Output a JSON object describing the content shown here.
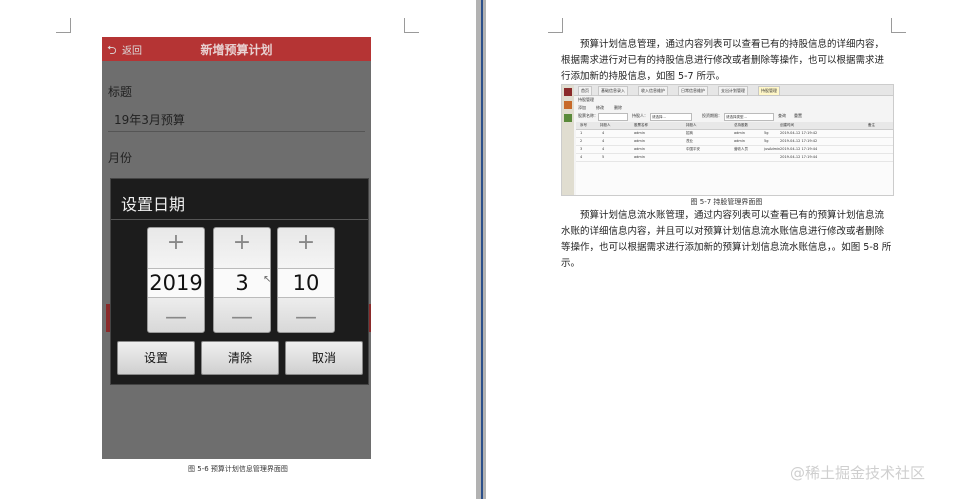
{
  "left_page": {
    "phone": {
      "back_label": "返回",
      "title": "新增预算计划",
      "fields": [
        {
          "label": "标题",
          "value": "19年3月预算"
        },
        {
          "label": "月份",
          "value": ""
        }
      ],
      "dialog": {
        "title": "设置日期",
        "plus": "+",
        "minus": "—",
        "year": "2019",
        "month": "3",
        "day": "10",
        "buttons": [
          "设置",
          "清除",
          "取消"
        ]
      }
    },
    "caption": "图 5-6 预算计划信息管理界面图"
  },
  "right_page": {
    "para1": "预算计划信息管理，通过内容列表可以查看已有的持股信息的详细内容，根据需求进行对已有的持股信息进行修改或者删除等操作，也可以根据需求进行添加新的持股信息，如图 5-7 所示。",
    "admin": {
      "tabs": [
        "首页",
        "基础信息录入",
        "收入信息维护",
        "日常信息维护",
        "支出计划管理",
        "持股管理"
      ],
      "header_title": "持股管理",
      "tools": [
        "添加",
        "修改",
        "删除"
      ],
      "search_labels": [
        "股票名称：",
        "持股人：",
        "投资期限：",
        "关闭"
      ],
      "search_placeholders": [
        "请选择...",
        "请选择...",
        "请选择类型..."
      ],
      "search_buttons": [
        "查询",
        "重置"
      ],
      "columns": [
        "序号",
        "持股人",
        "股票名称",
        "持股人",
        "总持股数",
        "创建时间",
        "备注"
      ],
      "rows": [
        [
          "1",
          "4",
          "admin",
          "招商",
          "admin",
          "5g",
          "2019-04-12 17:19:42"
        ],
        [
          "2",
          "4",
          "admin",
          "茂业",
          "admin",
          "5g",
          "2019-04-12 17:19:42"
        ],
        [
          "3",
          "4",
          "admin",
          "中国平安",
          "营收人员",
          "jusAdmin",
          "2019-04-12 17:19:44"
        ],
        [
          "4",
          "5",
          "admin",
          "",
          "",
          "",
          "2019-04-12 17:19:44"
        ]
      ]
    },
    "caption": "图 5-7 持股管理界面图",
    "para2": "预算计划信息流水账管理，通过内容列表可以查看已有的预算计划信息流水账的详细信息内容，并且可以对预算计划信息流水账信息进行修改或者删除等操作，也可以根据需求进行添加新的预算计划信息流水账信息，。如图 5-8 所示。"
  },
  "watermark": "@稀土掘金技术社区"
}
